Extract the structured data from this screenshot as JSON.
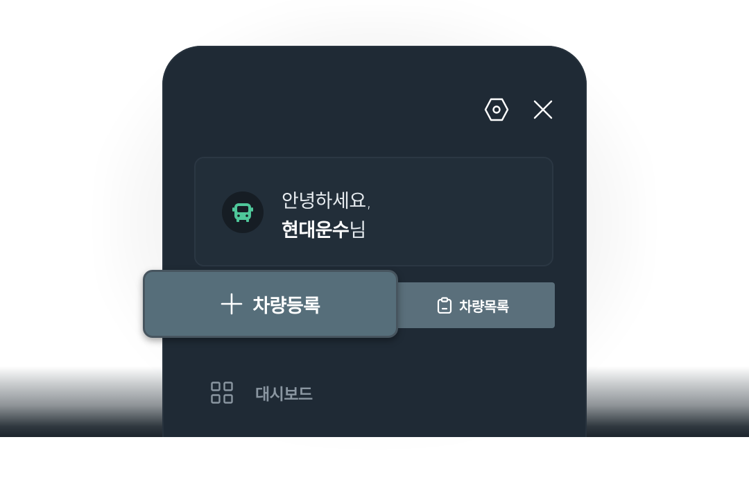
{
  "greeting": {
    "line1": "안녕하세요,",
    "company": "현대운수",
    "suffix": "님"
  },
  "actions": {
    "register_label": "차량등록",
    "list_label": "차량목록"
  },
  "nav": {
    "dashboard_label": "대시보드"
  },
  "icons": {
    "settings": "hexagon-settings-icon",
    "close": "close-icon",
    "avatar": "bus-icon",
    "register": "plus-icon",
    "list": "clipboard-icon",
    "dashboard": "grid-icon"
  },
  "colors": {
    "panel_bg": "#1f2a35",
    "card_bg": "#222e39",
    "button_bg": "#5a6f7b",
    "accent_green": "#4fc79a",
    "muted_text": "#8a96a1"
  }
}
